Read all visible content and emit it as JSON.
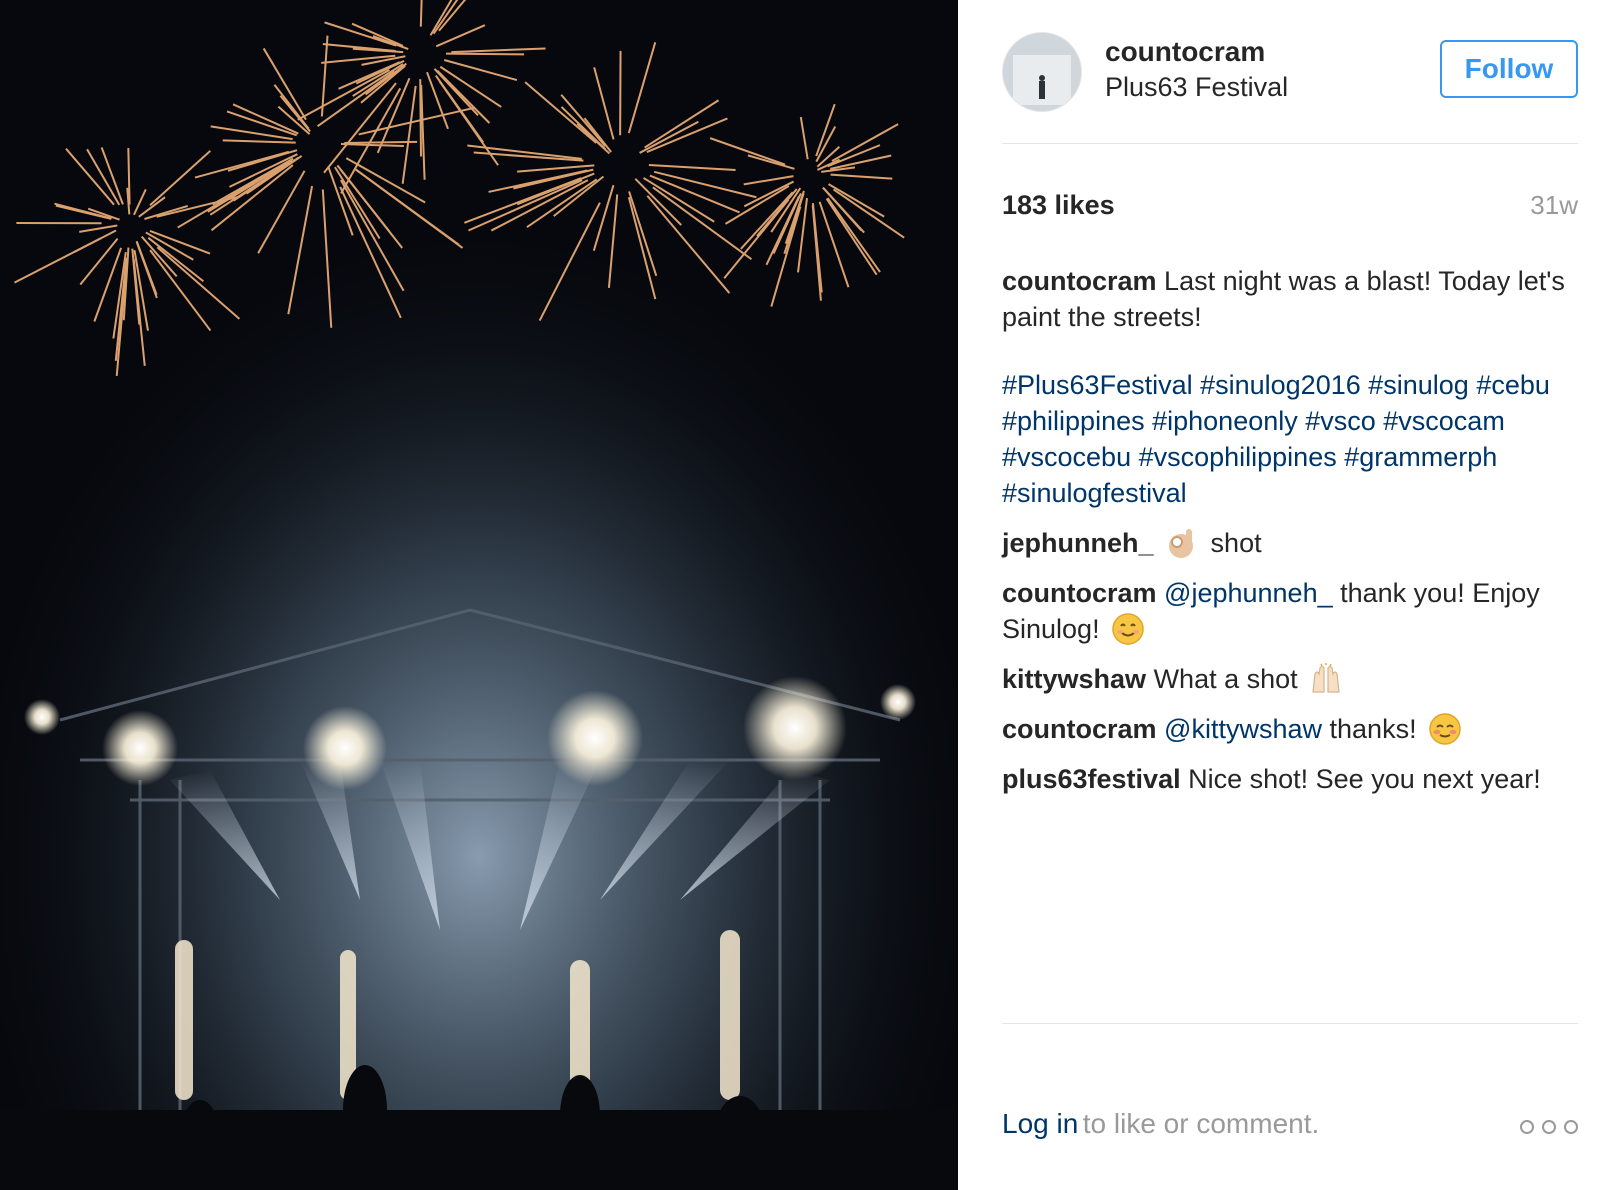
{
  "post": {
    "username": "countocram",
    "location": "Plus63 Festival",
    "follow_label": "Follow",
    "likes": "183 likes",
    "timestamp": "31w"
  },
  "caption": {
    "username": "countocram",
    "text": "Last night was a blast! Today let's paint the streets!",
    "hashtags": "#Plus63Festival #sinulog2016 #sinulog #cebu #philippines #iphoneonly #vsco #vscocam #vscocebu #vscophilippines #grammerph #sinulogfestival"
  },
  "comments": [
    {
      "username": "jephunneh_",
      "emoji": "ok-hand",
      "text": "shot"
    },
    {
      "username": "countocram",
      "mention": "@jephunneh_",
      "text": "thank you! Enjoy Sinulog!",
      "emoji": "smiling-face"
    },
    {
      "username": "kittywshaw",
      "text": "What a shot",
      "emoji": "raised-hands"
    },
    {
      "username": "countocram",
      "mention": "@kittywshaw",
      "text": "thanks!",
      "emoji": "blushing-face"
    },
    {
      "username": "plus63festival",
      "text": "Nice shot! See you next year!"
    }
  ],
  "footer": {
    "login_label": "Log in",
    "login_rest": "to like or comment."
  },
  "colors": {
    "link_blue": "#003569",
    "follow_blue": "#3897f0",
    "muted": "#999999"
  }
}
